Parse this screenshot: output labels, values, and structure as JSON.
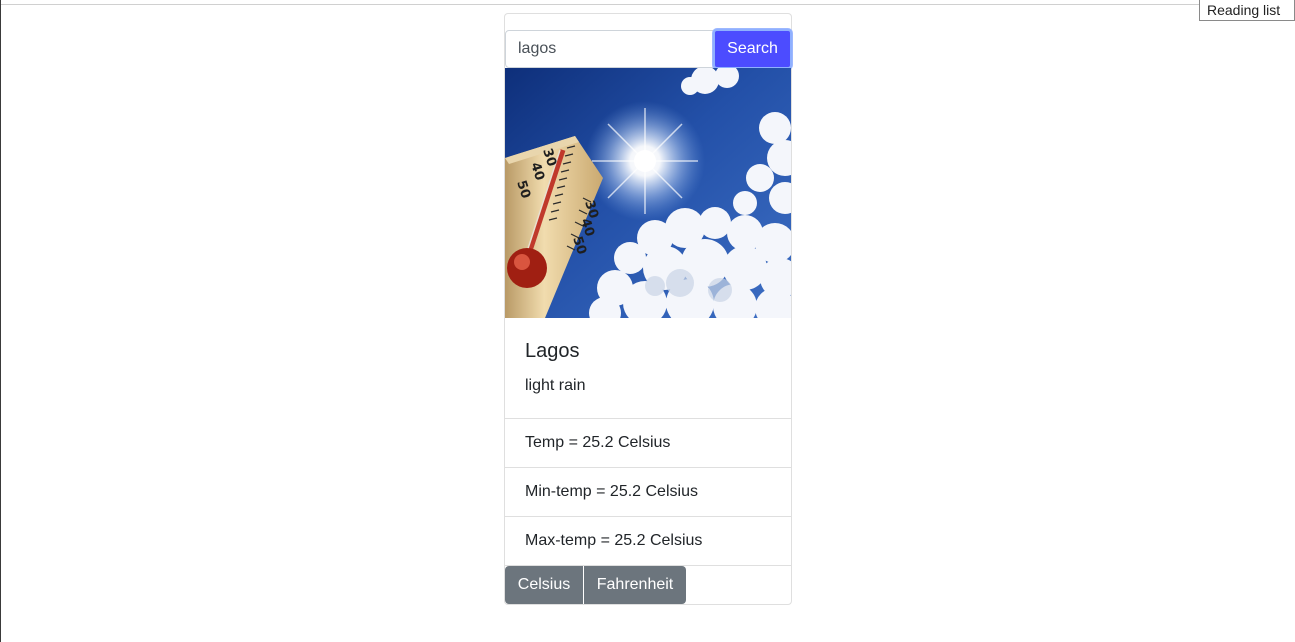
{
  "tooltip": {
    "text": "Reading list"
  },
  "search": {
    "value": "lagos",
    "button_label": "Search"
  },
  "image": {
    "alt": "thermometer-in-sun"
  },
  "weather": {
    "city": "Lagos",
    "description": "light rain",
    "temp": "Temp = 25.2 Celsius",
    "min_temp": "Min-temp = 25.2 Celsius",
    "max_temp": "Max-temp = 25.2 Celsius"
  },
  "units": {
    "celsius_label": "Celsius",
    "fahrenheit_label": "Fahrenheit"
  },
  "colors": {
    "search_button": "#4c4cff",
    "unit_button": "#6c757d"
  }
}
